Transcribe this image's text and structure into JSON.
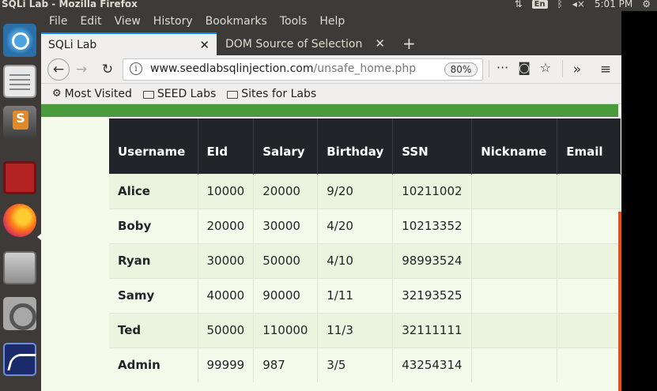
{
  "system": {
    "window_title": "SQLi Lab - Mozilla Firefox",
    "keyboard": "En",
    "clock": "5:01 PM"
  },
  "menu": [
    "File",
    "Edit",
    "View",
    "History",
    "Bookmarks",
    "Tools",
    "Help"
  ],
  "tabs": [
    {
      "label": "SQLi Lab",
      "active": true
    },
    {
      "label": "DOM Source of Selection",
      "active": false
    }
  ],
  "navbar": {
    "url_host": "www.seedlabsqlinjection.com",
    "url_path": "/unsafe_home.php",
    "zoom": "80%"
  },
  "bookmarks": [
    "Most Visited",
    "SEED Labs",
    "Sites for Labs"
  ],
  "table": {
    "headers": [
      "Username",
      "EId",
      "Salary",
      "Birthday",
      "SSN",
      "Nickname",
      "Email"
    ],
    "rows": [
      [
        "Alice",
        "10000",
        "20000",
        "9/20",
        "10211002",
        "",
        ""
      ],
      [
        "Boby",
        "20000",
        "30000",
        "4/20",
        "10213352",
        "",
        ""
      ],
      [
        "Ryan",
        "30000",
        "50000",
        "4/10",
        "98993524",
        "",
        ""
      ],
      [
        "Samy",
        "40000",
        "90000",
        "1/11",
        "32193525",
        "",
        ""
      ],
      [
        "Ted",
        "50000",
        "110000",
        "11/3",
        "32111111",
        "",
        ""
      ],
      [
        "Admin",
        "99999",
        "987",
        "3/5",
        "43254314",
        "",
        ""
      ]
    ]
  },
  "colors": {
    "header_bg": "#212529",
    "green_bar": "#4a9a3e",
    "row_alt": "#eaf4de"
  }
}
